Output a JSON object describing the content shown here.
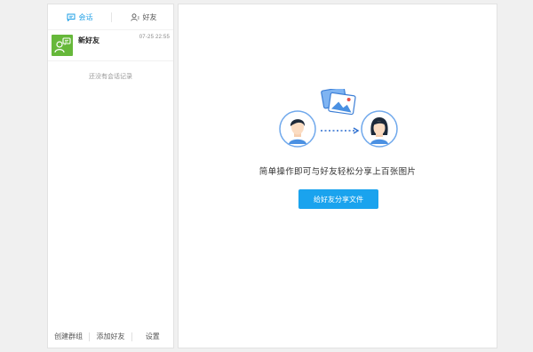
{
  "sidebar": {
    "tabs": [
      {
        "label": "会话",
        "icon": "chat-icon",
        "active": true
      },
      {
        "label": "好友",
        "icon": "friends-icon",
        "active": false
      }
    ],
    "conversations": [
      {
        "name": "新好友",
        "time": "07-25 22:55",
        "avatar_icon": "new-friend-icon",
        "avatar_color": "#66b83a"
      }
    ],
    "empty_text": "还没有会话记录",
    "bottom_buttons": [
      {
        "label": "创建群组"
      },
      {
        "label": "添加好友"
      },
      {
        "label": "设置"
      }
    ]
  },
  "main": {
    "title": "简单操作即可与好友轻松分享上百张图片",
    "share_button": "给好友分享文件"
  },
  "colors": {
    "accent": "#1e9fe6",
    "button": "#1aa3ee",
    "avatar_green": "#66b83a"
  }
}
